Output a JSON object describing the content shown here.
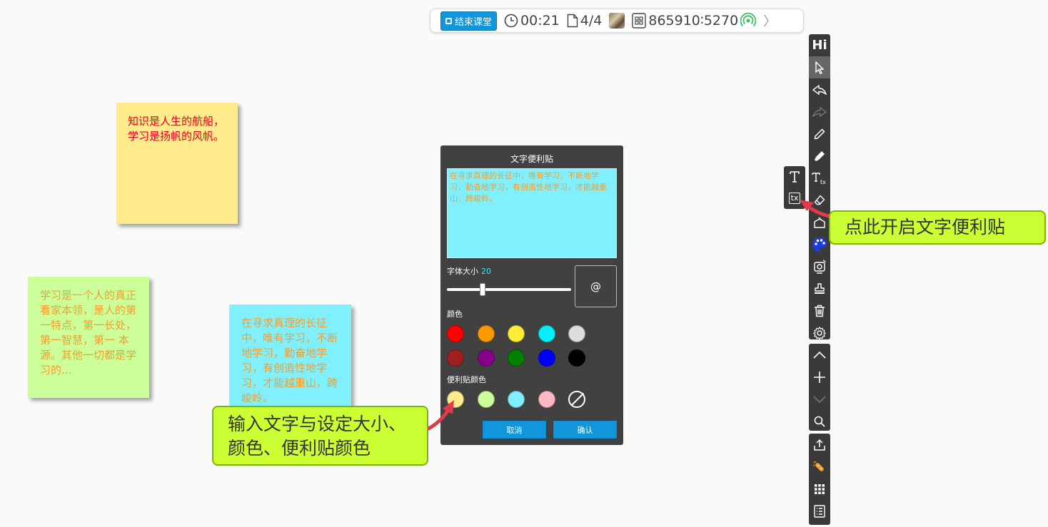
{
  "topbar": {
    "end_class_label": "结束课堂",
    "timer": "00:21",
    "pages": "4/4",
    "room_code": "865910∶5270",
    "colors": {
      "end_button": "#1296db",
      "signal": "#3cc060"
    }
  },
  "notes": [
    {
      "text": "知识是人生的航船，学习是扬帆的风帆。",
      "bg": "#ffea8c",
      "color": "#e8001c"
    },
    {
      "text": "学习是一个人的真正看家本领，是人的第一特点，第一长处，第一智慧，第一 本源。其他一切都是学习的...",
      "bg": "#ccff99",
      "color": "#f0a030"
    },
    {
      "text": "在寻求真理的长征中，唯有学习，不断地学习，勤奋地学习，有创造性地学习，才能越重山，跨峻岭。",
      "bg": "#80f0ff",
      "color": "#f0a030"
    }
  ],
  "dialog": {
    "title": "文字便利贴",
    "text_value": "在寻求真理的长征中，唯有学习，不断地学习，勤奋地学习，有创造性地学习，才能越重山，跨峻岭。",
    "font_size_label": "字体大小",
    "font_size_value": "20",
    "font_size_fraction": 0.29,
    "preview_char": "@",
    "color_label": "颜色",
    "colors": [
      "#ff0000",
      "#ff9900",
      "#ffee33",
      "#00f0ff",
      "#dddddd",
      "#a02020",
      "#880088",
      "#008000",
      "#0000ff",
      "#000000"
    ],
    "note_color_label": "便利贴颜色",
    "note_colors": [
      "#ffea8c",
      "#ccff99",
      "#80f0ff",
      "#ffb8c8",
      "none"
    ],
    "cancel_label": "取消",
    "confirm_label": "确认"
  },
  "toolbar": {
    "hi_label": "Hi",
    "group1": [
      "pointer-icon",
      "undo-icon",
      "redo-icon",
      "pen-icon",
      "highlighter-icon",
      "text-tool-icon",
      "eraser-icon",
      "shape-icon",
      "palette-icon",
      "camera-icon",
      "stamp-icon",
      "trash-icon",
      "settings-icon"
    ],
    "group2": [
      "page-up-icon",
      "add-page-icon",
      "page-down-icon",
      "zoom-icon"
    ],
    "group3": [
      "share-icon",
      "sticker-icon",
      "apps-icon",
      "list-icon"
    ]
  },
  "flyout": {
    "text_label": "T",
    "note_label": "tx"
  },
  "callouts": {
    "enable_note": "点此开启文字便利贴",
    "input_hint": "输入文字与设定大小、颜色、便利贴颜色"
  }
}
